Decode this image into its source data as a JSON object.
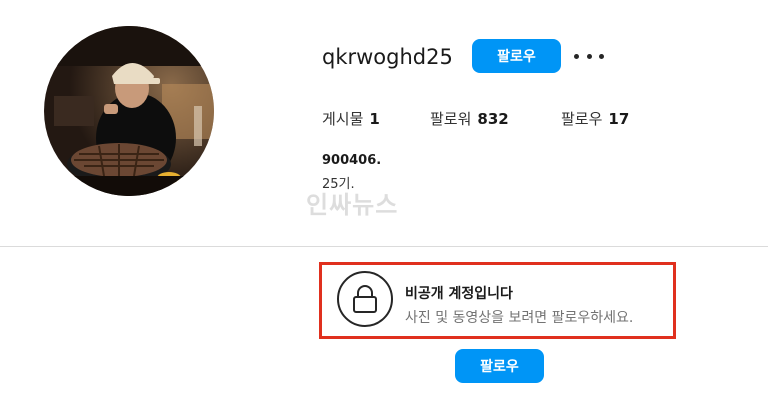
{
  "profile": {
    "username": "qkrwoghd25",
    "follow_label": "팔로우",
    "more_icon": "more-horizontal-icon",
    "avatar_icon": "profile-photo"
  },
  "stats": {
    "posts_label": "게시물",
    "posts_count": "1",
    "followers_label": "팔로워",
    "followers_count": "832",
    "following_label": "팔로우",
    "following_count": "17"
  },
  "bio": {
    "line1": "900406.",
    "line2": "25기."
  },
  "watermark": {
    "text": "인싸뉴스"
  },
  "private_notice": {
    "title": "비공개 계정입니다",
    "subtitle": "사진 및 동영상을 보려면 팔로우하세요.",
    "icon": "lock-icon",
    "follow_label": "팔로우"
  },
  "colors": {
    "accent": "#0095f6",
    "highlight_border": "#e0301e",
    "divider": "#dbdbdb"
  }
}
